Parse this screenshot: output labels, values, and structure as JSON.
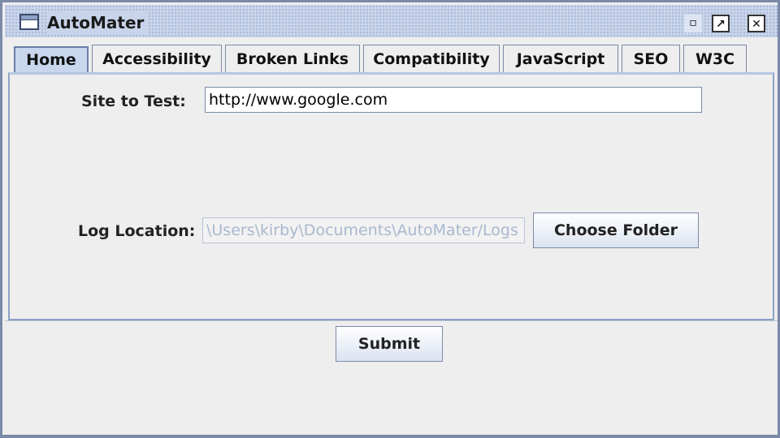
{
  "window": {
    "title": "AutoMater",
    "controls": {
      "minimize": "▫",
      "maximize": "↗",
      "close": "✕"
    }
  },
  "tabs": [
    {
      "label": "Home",
      "active": true
    },
    {
      "label": "Accessibility",
      "active": false
    },
    {
      "label": "Broken Links",
      "active": false
    },
    {
      "label": "Compatibility",
      "active": false
    },
    {
      "label": "JavaScript",
      "active": false
    },
    {
      "label": "SEO",
      "active": false
    },
    {
      "label": "W3C",
      "active": false
    }
  ],
  "home": {
    "site_label": "Site to Test:",
    "site_value": "http://www.google.com",
    "log_label": "Log Location:",
    "log_value": "\\Users\\kirby\\Documents\\AutoMater/Logs",
    "choose_folder_label": "Choose Folder"
  },
  "footer": {
    "submit_label": "Submit"
  },
  "colors": {
    "titlebar": "#c8d4ea",
    "frame_border": "#7a8aa8",
    "active_tab": "#c8d6ee",
    "background": "#eeeeee"
  }
}
